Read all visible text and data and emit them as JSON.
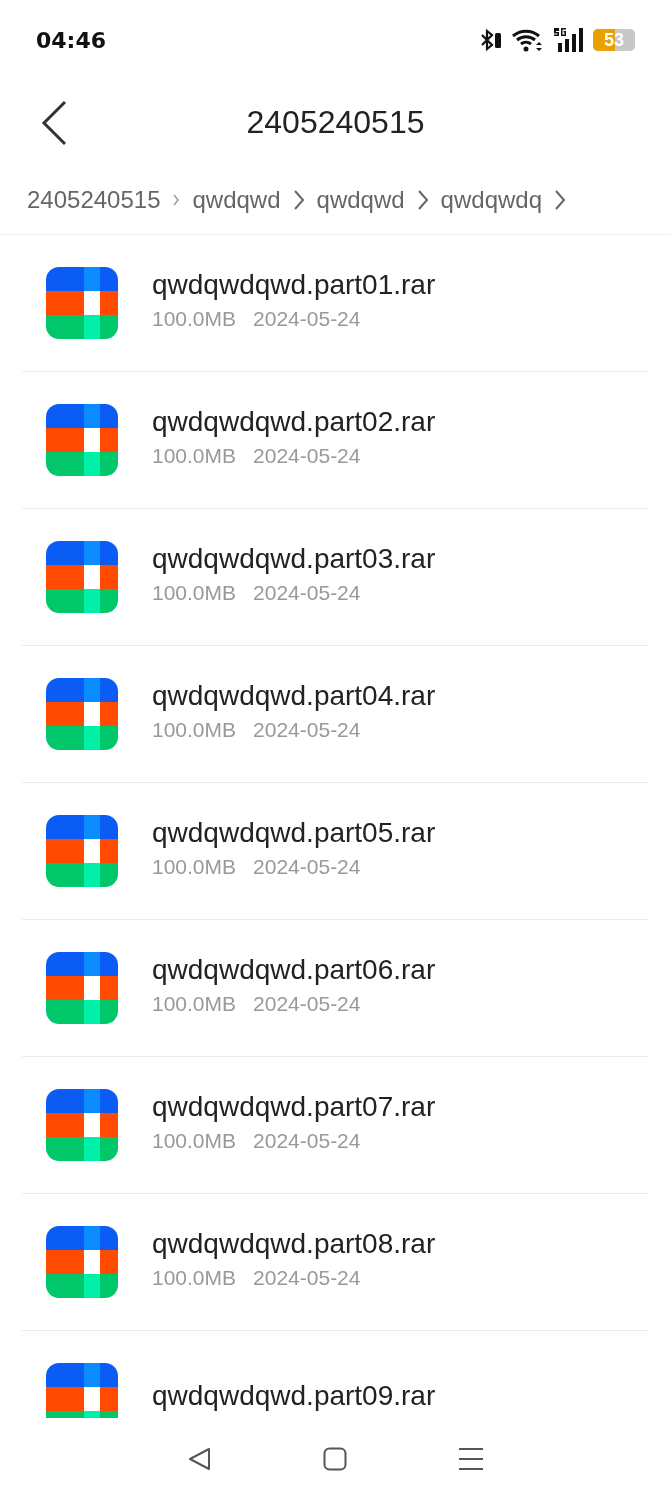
{
  "status_bar": {
    "time": "04:46",
    "battery": "53"
  },
  "header": {
    "title": "2405240515"
  },
  "breadcrumb": [
    "2405240515",
    "qwdqwd",
    "qwdqwd",
    "qwdqwdq"
  ],
  "files": [
    {
      "name": "qwdqwdqwd.part01.rar",
      "size": "100.0MB",
      "date": "2024-05-24"
    },
    {
      "name": "qwdqwdqwd.part02.rar",
      "size": "100.0MB",
      "date": "2024-05-24"
    },
    {
      "name": "qwdqwdqwd.part03.rar",
      "size": "100.0MB",
      "date": "2024-05-24"
    },
    {
      "name": "qwdqwdqwd.part04.rar",
      "size": "100.0MB",
      "date": "2024-05-24"
    },
    {
      "name": "qwdqwdqwd.part05.rar",
      "size": "100.0MB",
      "date": "2024-05-24"
    },
    {
      "name": "qwdqwdqwd.part06.rar",
      "size": "100.0MB",
      "date": "2024-05-24"
    },
    {
      "name": "qwdqwdqwd.part07.rar",
      "size": "100.0MB",
      "date": "2024-05-24"
    },
    {
      "name": "qwdqwdqwd.part08.rar",
      "size": "100.0MB",
      "date": "2024-05-24"
    },
    {
      "name": "qwdqwdqwd.part09.rar"
    }
  ]
}
